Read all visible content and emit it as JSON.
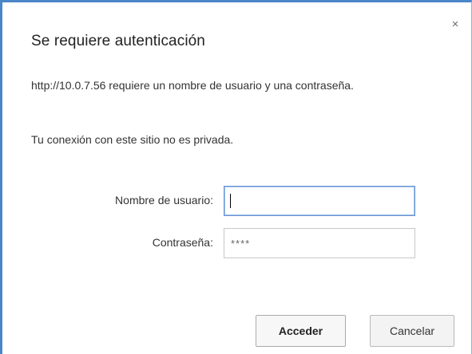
{
  "dialog": {
    "title": "Se requiere autenticación",
    "close_icon_glyph": "×",
    "message_line1": "http://10.0.7.56 requiere un nombre de usuario y una contraseña.",
    "message_line2": "Tu conexión con este sitio no es privada."
  },
  "form": {
    "username": {
      "label": "Nombre de usuario:",
      "value": ""
    },
    "password": {
      "label": "Contraseña:",
      "value": "****"
    }
  },
  "buttons": {
    "submit_label": "Acceder",
    "cancel_label": "Cancelar"
  },
  "colors": {
    "dialog_border": "#4a86c8",
    "focus_border": "#6b98d6"
  },
  "icons": {
    "close": "close-icon"
  }
}
